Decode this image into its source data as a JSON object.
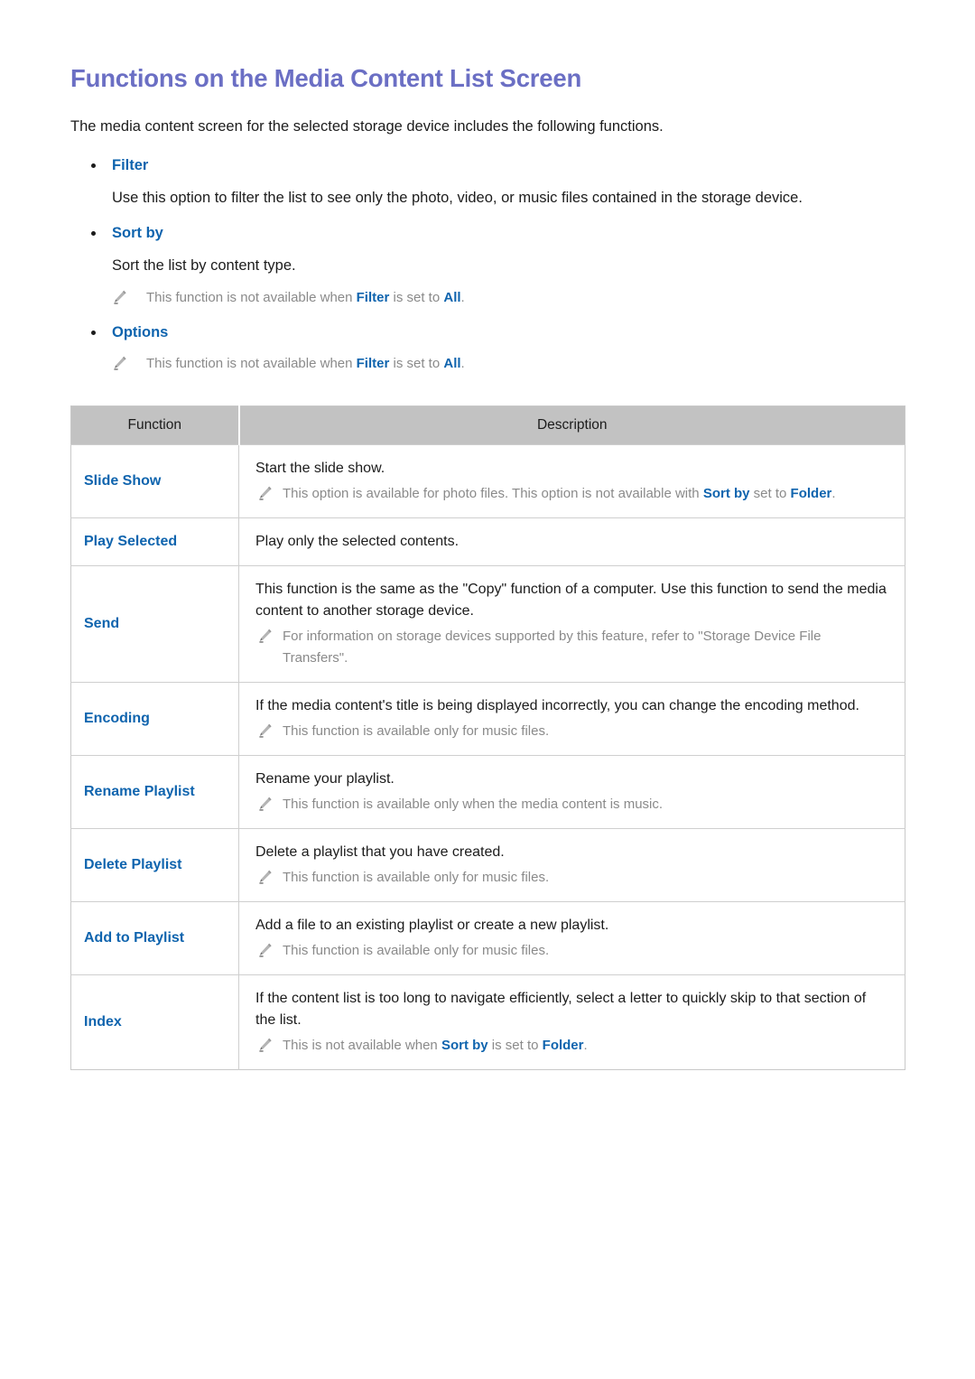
{
  "document": {
    "title": "Functions on the Media Content List Screen",
    "intro": "The media content screen for the selected storage device includes the following functions."
  },
  "sections": [
    {
      "heading": "Filter",
      "body": "Use this option to filter the list to see only the photo, video, or music files contained in the storage device."
    },
    {
      "heading": "Sort by",
      "body": "Sort the list by content type.",
      "note": {
        "prefix": "This function is not available when ",
        "term1": "Filter",
        "middle": " is set to ",
        "term2": "All",
        "suffix": "."
      }
    },
    {
      "heading": "Options",
      "note": {
        "prefix": "This function is not available when ",
        "term1": "Filter",
        "middle": " is set to ",
        "term2": "All",
        "suffix": "."
      }
    }
  ],
  "table": {
    "headers": {
      "function": "Function",
      "description": "Description"
    },
    "rows": [
      {
        "function": "Slide Show",
        "description": "Start the slide show.",
        "note": {
          "prefix": "This option is available for photo files. This option is not available with ",
          "term1": "Sort by",
          "middle": " set to ",
          "term2": "Folder",
          "suffix": "."
        }
      },
      {
        "function": "Play Selected",
        "description": "Play only the selected contents."
      },
      {
        "function": "Send",
        "description": "This function is the same as the \"Copy\" function of a computer. Use this function to send the media content to another storage device.",
        "note": {
          "prefix": "For information on storage devices supported by this feature, refer to \"Storage Device File Transfers\".",
          "term1": "",
          "middle": "",
          "term2": "",
          "suffix": ""
        }
      },
      {
        "function": "Encoding",
        "description": "If the media content's title is being displayed incorrectly, you can change the encoding method.",
        "note": {
          "prefix": "This function is available only for music files.",
          "term1": "",
          "middle": "",
          "term2": "",
          "suffix": ""
        }
      },
      {
        "function": "Rename Playlist",
        "description": "Rename your playlist.",
        "note": {
          "prefix": "This function is available only when the media content is music.",
          "term1": "",
          "middle": "",
          "term2": "",
          "suffix": ""
        }
      },
      {
        "function": "Delete Playlist",
        "description": "Delete a playlist that you have created.",
        "note": {
          "prefix": "This function is available only for music files.",
          "term1": "",
          "middle": "",
          "term2": "",
          "suffix": ""
        }
      },
      {
        "function": "Add to Playlist",
        "description": "Add a file to an existing playlist or create a new playlist.",
        "note": {
          "prefix": "This function is available only for music files.",
          "term1": "",
          "middle": "",
          "term2": "",
          "suffix": ""
        }
      },
      {
        "function": "Index",
        "description": "If the content list is too long to navigate efficiently, select a letter to quickly skip to that section of the list.",
        "note": {
          "prefix": "This is not available when ",
          "term1": "Sort by",
          "middle": " is set to ",
          "term2": "Folder",
          "suffix": "."
        }
      }
    ]
  },
  "colors": {
    "title": "#6b6fc4",
    "link": "#0f64ae",
    "note_text": "#8a8a8a",
    "table_header_bg": "#c2c2c2",
    "border": "#cfcfcf"
  },
  "icons": {
    "note": "pencil-icon",
    "bullet": "bullet-dot"
  }
}
